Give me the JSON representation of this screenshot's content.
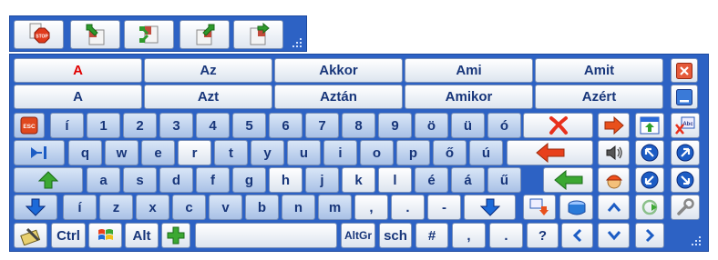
{
  "toolbar": {
    "buttons": [
      {
        "name": "stop-button",
        "icon": "stop-sign-icon",
        "label": "STOP"
      },
      {
        "name": "move-keyboard-up-button",
        "icon": "arrow-into-page-icon"
      },
      {
        "name": "dock-keyboard-button",
        "icon": "split-arrows-icon"
      },
      {
        "name": "move-keyboard-right-button",
        "icon": "arrow-out-page-icon"
      },
      {
        "name": "move-keyboard-down-button",
        "icon": "arrow-page-icon"
      }
    ]
  },
  "suggestions": {
    "row1": [
      "A",
      "Az",
      "Akkor",
      "Ami",
      "Amit"
    ],
    "row2": [
      "A",
      "Azt",
      "Aztán",
      "Amikor",
      "Azért"
    ],
    "highlight_color": "#e00000"
  },
  "keys": {
    "row1": [
      "í",
      "1",
      "2",
      "3",
      "4",
      "5",
      "6",
      "7",
      "8",
      "9",
      "ö",
      "ü",
      "ó"
    ],
    "row2": [
      "q",
      "w",
      "e",
      "r",
      "t",
      "y",
      "u",
      "i",
      "o",
      "p",
      "ő",
      "ú"
    ],
    "row3": [
      "a",
      "s",
      "d",
      "f",
      "g",
      "h",
      "j",
      "k",
      "l",
      "é",
      "á",
      "ű"
    ],
    "row4": [
      "í",
      "z",
      "x",
      "c",
      "v",
      "b",
      "n",
      "m",
      ",",
      ".",
      "-"
    ],
    "esc": "ESC",
    "ctrl": "Ctrl",
    "alt": "Alt",
    "altgr": "AltGr",
    "sch": "sch",
    "hash": "#",
    "comma": ",",
    "period": ".",
    "question": "?",
    "abc_label": "Abc"
  },
  "colors": {
    "panel": "#2d62c4",
    "key_blue": "#c4d6f0",
    "key_white": "#ffffff",
    "key_text": "#18367a",
    "red_arrow": "#e8301c",
    "green_arrow": "#3ca832",
    "nav_circle": "#1c5cc4"
  }
}
